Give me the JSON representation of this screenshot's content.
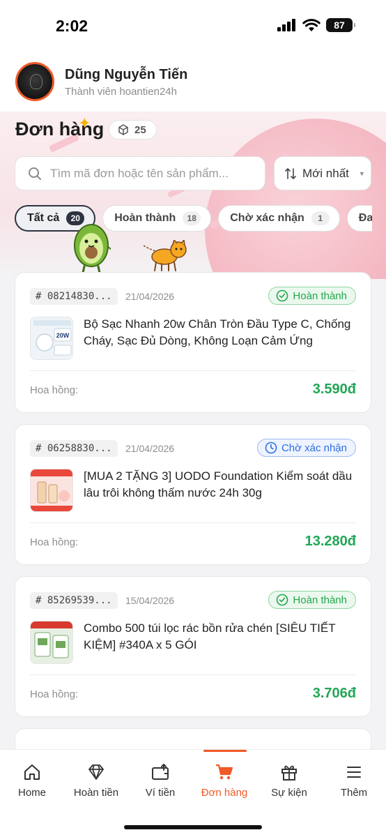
{
  "status_bar": {
    "time": "2:02",
    "battery": "87"
  },
  "user": {
    "name": "Dũng Nguyễn Tiến",
    "role": "Thành viên hoantien24h"
  },
  "orders_header": {
    "title": "Đơn hàng",
    "count": "25"
  },
  "search": {
    "placeholder": "Tìm mã đơn hoặc tên sản phẩm..."
  },
  "sort": {
    "label": "Mới nhất"
  },
  "tabs": [
    {
      "label": "Tất cả",
      "count": "20"
    },
    {
      "label": "Hoàn thành",
      "count": "18"
    },
    {
      "label": "Chờ xác nhận",
      "count": "1"
    },
    {
      "label": "Đan",
      "count": ""
    }
  ],
  "orders": [
    {
      "id": "# 08214830...",
      "date": "21/04/2026",
      "status": "Hoàn thành",
      "product": "Bộ Sạc Nhanh 20w Chân Tròn Đầu Type C, Chống Cháy, Sạc Đủ Dòng, Không Loạn Cảm Ứng",
      "commission_label": "Hoa hồng:",
      "commission": "3.590đ",
      "thumb_text": "20W"
    },
    {
      "id": "# 06258830...",
      "date": "21/04/2026",
      "status": "Chờ xác nhận",
      "product": "[MUA 2 TẶNG 3] UODO Foundation Kiểm soát dầu lâu trôi không thấm nước 24h 30g",
      "commission_label": "Hoa hồng:",
      "commission": "13.280đ"
    },
    {
      "id": "# 85269539...",
      "date": "15/04/2026",
      "status": "Hoàn thành",
      "product": "Combo 500 túi lọc rác bồn rửa chén [SIÊU TIẾT KIỆM] #340A x 5 GÓI",
      "commission_label": "Hoa hồng:",
      "commission": "3.706đ"
    }
  ],
  "bottom_nav": [
    {
      "label": "Home",
      "icon": "home-icon"
    },
    {
      "label": "Hoàn tiền",
      "icon": "diamond-icon"
    },
    {
      "label": "Ví tiền",
      "icon": "wallet-icon"
    },
    {
      "label": "Đơn hàng",
      "icon": "cart-icon",
      "active": true
    },
    {
      "label": "Sự kiện",
      "icon": "gift-icon"
    },
    {
      "label": "Thêm",
      "icon": "menu-icon"
    }
  ],
  "colors": {
    "accent": "#f05a28",
    "success": "#21a656",
    "pending": "#2f6fe0"
  }
}
